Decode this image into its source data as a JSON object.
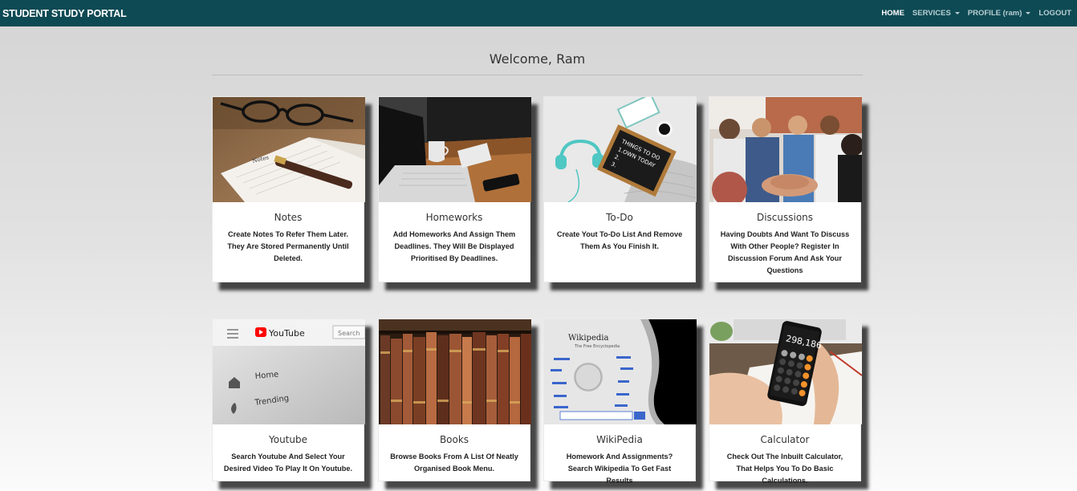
{
  "navbar": {
    "brand": "STUDENT STUDY PORTAL",
    "links": [
      {
        "label": "HOME",
        "active": true
      },
      {
        "label": "SERVICES",
        "dropdown": true
      },
      {
        "label": "PROFILE (ram)",
        "dropdown": true
      },
      {
        "label": "LOGOUT"
      }
    ]
  },
  "welcome": "Welcome, Ram",
  "cards": [
    {
      "title": "Notes",
      "desc": "Create Notes To Refer Them Later. They Are Stored Permanently Until Deleted.",
      "icon": "notes-image"
    },
    {
      "title": "Homeworks",
      "desc": "Add Homeworks And Assign Them Deadlines. They Will Be Displayed Prioritised By Deadlines.",
      "icon": "laptop-desk-image"
    },
    {
      "title": "To-Do",
      "desc": "Create Yout To-Do List And Remove Them As You Finish It.",
      "icon": "todo-board-image"
    },
    {
      "title": "Discussions",
      "desc": "Having Doubts And Want To Discuss With Other People? Register In Discussion Forum And Ask Your Questions",
      "icon": "group-hands-image"
    },
    {
      "title": "Youtube",
      "desc": "Search Youtube And Select Your Desired Video To Play It On Youtube.",
      "icon": "youtube-screen-image"
    },
    {
      "title": "Books",
      "desc": "Browse Books From A List Of Neatly Organised Book Menu.",
      "icon": "bookshelf-image"
    },
    {
      "title": "WikiPedia",
      "desc": "Homework And Assignments? Search Wikipedia To Get Fast Results",
      "icon": "wikipedia-screen-image"
    },
    {
      "title": "Calculator",
      "desc": "Check Out The Inbuilt Calculator, That Helps You To Do Basic Calculations.",
      "icon": "phone-calculator-image"
    }
  ],
  "images": {
    "todo": {
      "board": "THINGS TO DO",
      "line1": "1.OWN TODAY",
      "line2": "2.",
      "line3": "3."
    },
    "youtube": {
      "logo": "YouTube",
      "search": "Search",
      "home": "Home",
      "trending": "Trending"
    },
    "wikipedia": {
      "title": "Wikipedia",
      "subtitle": "The Free Encyclopedia"
    },
    "calculator": {
      "display": "298,186"
    }
  },
  "colors": {
    "navbar": "#0e4a54",
    "youtube_red": "#ff0000",
    "calc_orange": "#f3922b"
  }
}
